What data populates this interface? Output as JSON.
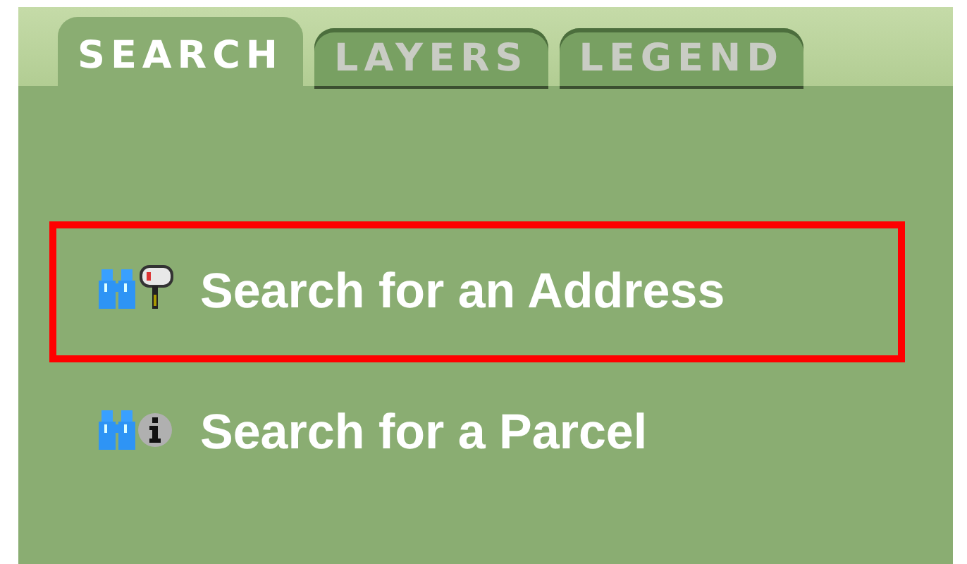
{
  "tabs": [
    {
      "label": "SEARCH",
      "selected": true
    },
    {
      "label": "LAYERS",
      "selected": false
    },
    {
      "label": "LEGEND",
      "selected": false
    }
  ],
  "items": [
    {
      "label": "Search for an Address",
      "kind": "address",
      "selected": true
    },
    {
      "label": "Search for a Parcel",
      "kind": "parcel",
      "selected": false
    }
  ]
}
